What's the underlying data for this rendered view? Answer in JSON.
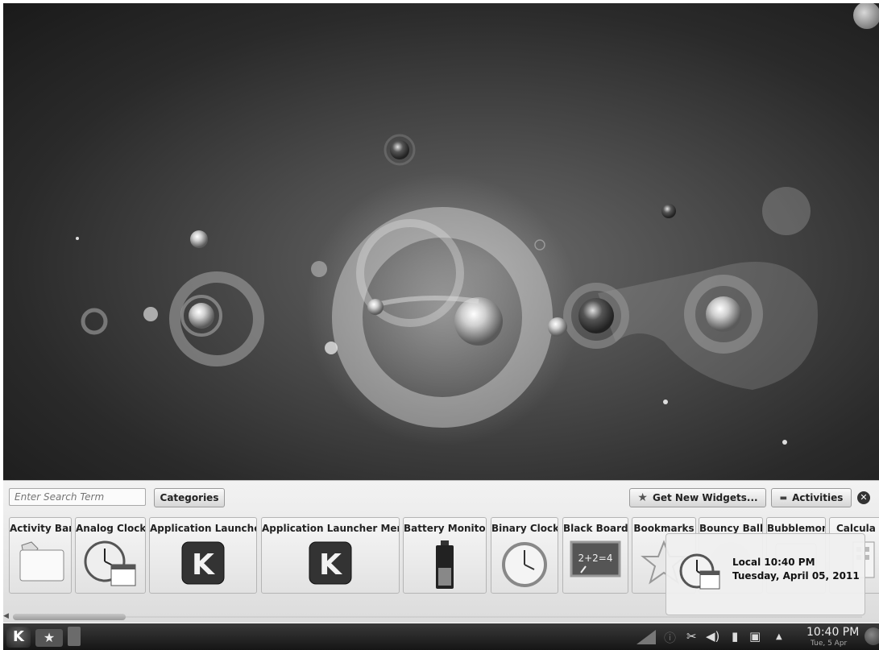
{
  "explorer": {
    "search_placeholder": "Enter Search Term",
    "categories_label": "Categories",
    "get_new_widgets_label": "Get New Widgets...",
    "activities_label": "Activities",
    "widgets": [
      {
        "label": "Activity Bar",
        "icon": "folder-icon"
      },
      {
        "label": "Analog Clock",
        "icon": "clock-calendar-icon"
      },
      {
        "label": "Application Launcher",
        "icon": "kde-logo-icon"
      },
      {
        "label": "Application Launcher Menu",
        "icon": "kde-logo-icon"
      },
      {
        "label": "Battery Monitor",
        "icon": "battery-icon"
      },
      {
        "label": "Binary Clock",
        "icon": "clock-icon"
      },
      {
        "label": "Black Board",
        "icon": "blackboard-icon"
      },
      {
        "label": "Bookmarks",
        "icon": "star-icon"
      },
      {
        "label": "Bouncy Ball",
        "icon": "ball-icon"
      },
      {
        "label": "Bubblemon",
        "icon": "bubblemon-icon"
      },
      {
        "label": "Calcula",
        "icon": "calculator-icon"
      }
    ],
    "blackboard_text": "2+2=4"
  },
  "tooltip": {
    "title": "Local 10:40 PM",
    "date": "Tuesday, April 05, 2011"
  },
  "taskbar": {
    "kickoff_glyph": "K",
    "clock_time": "10:40 PM",
    "clock_date": "Tue, 5 Apr"
  }
}
